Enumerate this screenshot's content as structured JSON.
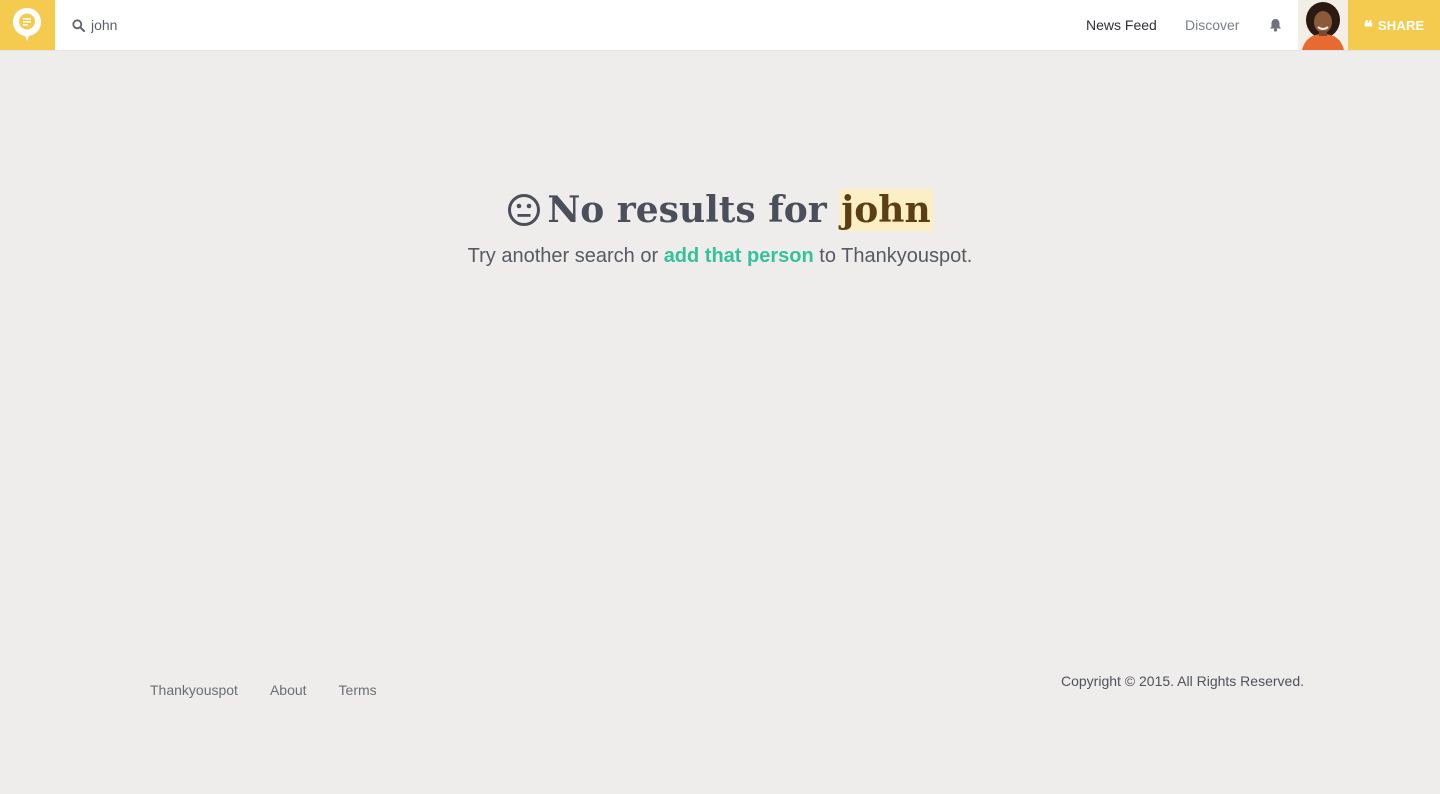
{
  "header": {
    "search_value": "john",
    "nav_news_feed": "News Feed",
    "nav_discover": "Discover",
    "share_label": "SHARE",
    "share_quote": "❝"
  },
  "main": {
    "title_prefix": "No results for",
    "search_term": "john",
    "sub_before": "Try another search or ",
    "sub_link": "add that person",
    "sub_after": " to Thankyouspot."
  },
  "footer": {
    "links": [
      "Thankyouspot",
      "About",
      "Terms"
    ],
    "copyright": "Copyright © 2015. All Rights Reserved."
  },
  "colors": {
    "accent_yellow": "#f5cb4f",
    "link_green": "#33c29a",
    "highlight": "#fcefc6",
    "background": "#efedeb"
  },
  "icons": [
    "logo-icon",
    "search-icon",
    "bell-icon",
    "neutral-face-icon",
    "quote-icon"
  ]
}
